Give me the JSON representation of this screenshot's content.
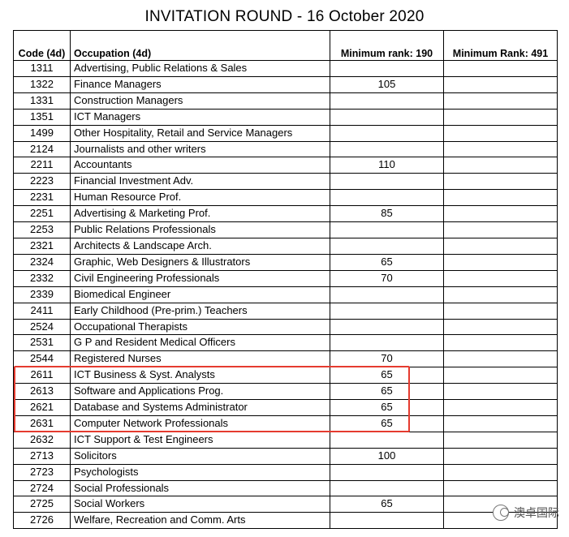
{
  "title": "INVITATION ROUND - 16 October 2020",
  "headers": {
    "code": "Code (4d)",
    "occupation": "Occupation (4d)",
    "min190": "Minimum rank: 190",
    "min491": "Minimum Rank: 491"
  },
  "rows": [
    {
      "code": "1311",
      "occupation": "Advertising, Public Relations & Sales",
      "r190": "",
      "r491": ""
    },
    {
      "code": "1322",
      "occupation": "Finance Managers",
      "r190": "105",
      "r491": ""
    },
    {
      "code": "1331",
      "occupation": "Construction Managers",
      "r190": "",
      "r491": ""
    },
    {
      "code": "1351",
      "occupation": "ICT Managers",
      "r190": "",
      "r491": ""
    },
    {
      "code": "1499",
      "occupation": "Other Hospitality, Retail and Service Managers",
      "r190": "",
      "r491": ""
    },
    {
      "code": "2124",
      "occupation": "Journalists and other writers",
      "r190": "",
      "r491": ""
    },
    {
      "code": "2211",
      "occupation": "Accountants",
      "r190": "110",
      "r491": ""
    },
    {
      "code": "2223",
      "occupation": "Financial Investment Adv.",
      "r190": "",
      "r491": ""
    },
    {
      "code": "2231",
      "occupation": "Human Resource Prof.",
      "r190": "",
      "r491": ""
    },
    {
      "code": "2251",
      "occupation": "Advertising & Marketing Prof.",
      "r190": "85",
      "r491": ""
    },
    {
      "code": "2253",
      "occupation": "Public Relations Professionals",
      "r190": "",
      "r491": ""
    },
    {
      "code": "2321",
      "occupation": "Architects & Landscape Arch.",
      "r190": "",
      "r491": ""
    },
    {
      "code": "2324",
      "occupation": "Graphic, Web Designers & Illustrators",
      "r190": "65",
      "r491": ""
    },
    {
      "code": "2332",
      "occupation": "Civil Engineering Professionals",
      "r190": "70",
      "r491": ""
    },
    {
      "code": "2339",
      "occupation": "Biomedical Engineer",
      "r190": "",
      "r491": ""
    },
    {
      "code": "2411",
      "occupation": "Early Childhood (Pre-prim.) Teachers",
      "r190": "",
      "r491": ""
    },
    {
      "code": "2524",
      "occupation": "Occupational Therapists",
      "r190": "",
      "r491": ""
    },
    {
      "code": "2531",
      "occupation": "G P and Resident Medical Officers",
      "r190": "",
      "r491": ""
    },
    {
      "code": "2544",
      "occupation": "Registered Nurses",
      "r190": "70",
      "r491": ""
    },
    {
      "code": "2611",
      "occupation": "ICT Business & Syst. Analysts",
      "r190": "65",
      "r491": ""
    },
    {
      "code": "2613",
      "occupation": "Software and Applications Prog.",
      "r190": "65",
      "r491": ""
    },
    {
      "code": "2621",
      "occupation": "Database and Systems Administrator",
      "r190": "65",
      "r491": ""
    },
    {
      "code": "2631",
      "occupation": "Computer Network Professionals",
      "r190": "65",
      "r491": ""
    },
    {
      "code": "2632",
      "occupation": "ICT Support & Test Engineers",
      "r190": "",
      "r491": ""
    },
    {
      "code": "2713",
      "occupation": "Solicitors",
      "r190": "100",
      "r491": ""
    },
    {
      "code": "2723",
      "occupation": "Psychologists",
      "r190": "",
      "r491": ""
    },
    {
      "code": "2724",
      "occupation": "Social Professionals",
      "r190": "",
      "r491": ""
    },
    {
      "code": "2725",
      "occupation": "Social Workers",
      "r190": "65",
      "r491": ""
    },
    {
      "code": "2726",
      "occupation": "Welfare, Recreation and Comm. Arts",
      "r190": "",
      "r491": ""
    }
  ],
  "watermark": {
    "icon": "wechat-icon",
    "text": "澳卓国际"
  },
  "colors": {
    "highlight_border": "#e53b2f"
  }
}
